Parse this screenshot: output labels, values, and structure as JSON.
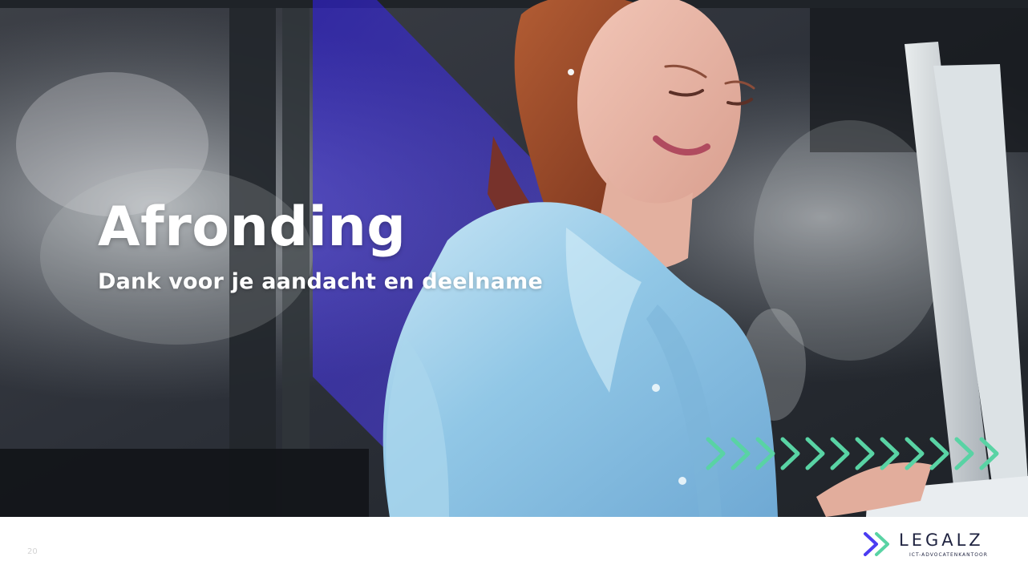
{
  "slide": {
    "title": "Afronding",
    "subtitle": "Dank voor je aandacht en deelname",
    "page_number": "20"
  },
  "brand": {
    "name": "LEGALZ",
    "tagline": "ICT-ADVOCATENKANTOOR",
    "logo_icon": "double-chevron-icon",
    "colors": {
      "navy": "#1f2340",
      "accent_blue": "#4b3cf2",
      "mint": "#59d3a4",
      "white": "#ffffff"
    }
  },
  "hero": {
    "image_icon": "woman-laptop-photo",
    "decorative_arrows_icon": "chevron-row-icon"
  }
}
